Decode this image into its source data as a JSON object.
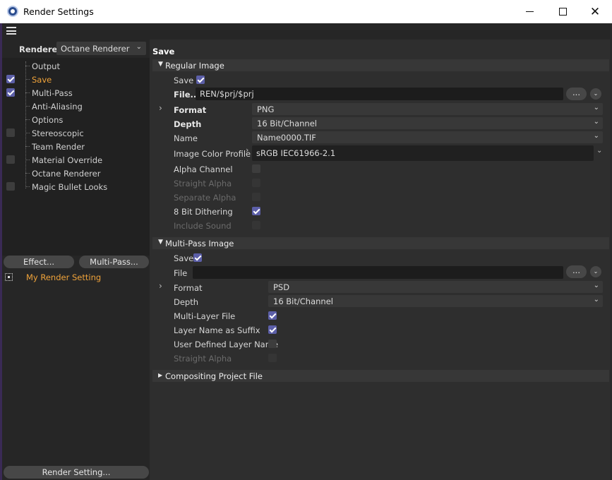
{
  "window": {
    "title": "Render Settings",
    "min_icon": "minimize-icon",
    "max_icon": "maximize-icon",
    "close_glyph": "✕"
  },
  "colors": {
    "accent_orange": "#f0a33a",
    "checkbox_checked": "#5c5fa8",
    "panel_bg": "#2e2e2e",
    "list_bg": "#212121"
  },
  "sidebar": {
    "renderer_label": "Renderer",
    "renderer_value": "Octane Renderer",
    "items": [
      {
        "label": "Output",
        "checkbox": "none"
      },
      {
        "label": "Save",
        "checkbox": "checked",
        "active": true
      },
      {
        "label": "Multi-Pass",
        "checkbox": "checked"
      },
      {
        "label": "Anti-Aliasing",
        "checkbox": "none"
      },
      {
        "label": "Options",
        "checkbox": "none"
      },
      {
        "label": "Stereoscopic",
        "checkbox": "unchecked"
      },
      {
        "label": "Team Render",
        "checkbox": "none"
      },
      {
        "label": "Material Override",
        "checkbox": "unchecked"
      },
      {
        "label": "Octane Renderer",
        "checkbox": "none"
      },
      {
        "label": "Magic Bullet Looks",
        "checkbox": "unchecked"
      }
    ],
    "effect_button": "Effect...",
    "multipass_button": "Multi-Pass...",
    "render_setting_item": "My Render Setting",
    "render_setting_button": "Render Setting..."
  },
  "main": {
    "title": "Save",
    "regular_image": {
      "header": "Regular Image",
      "save_label": "Save",
      "file_label": "File...",
      "file_value": "REN/$prj/$prj",
      "dots": "...",
      "format_label": "Format",
      "format_value": "PNG",
      "depth_label": "Depth",
      "depth_value": "16 Bit/Channel",
      "name_label": "Name",
      "name_value": "Name0000.TIF",
      "color_profile_label": "Image Color Profile",
      "color_profile_value": "sRGB IEC61966-2.1",
      "alpha_channel_label": "Alpha Channel",
      "straight_alpha_label": "Straight Alpha",
      "separate_alpha_label": "Separate Alpha",
      "dithering_label": "8 Bit Dithering",
      "include_sound_label": "Include Sound"
    },
    "multipass_image": {
      "header": "Multi-Pass Image",
      "save_label": "Save",
      "file_label": "File",
      "file_value": "",
      "dots": "...",
      "format_label": "Format",
      "format_value": "PSD",
      "depth_label": "Depth",
      "depth_value": "16 Bit/Channel",
      "multilayer_label": "Multi-Layer File",
      "layer_suffix_label": "Layer Name as Suffix",
      "user_layer_label": "User Defined Layer Name",
      "straight_alpha_label": "Straight Alpha"
    },
    "compositing": {
      "header": "Compositing Project File"
    }
  }
}
